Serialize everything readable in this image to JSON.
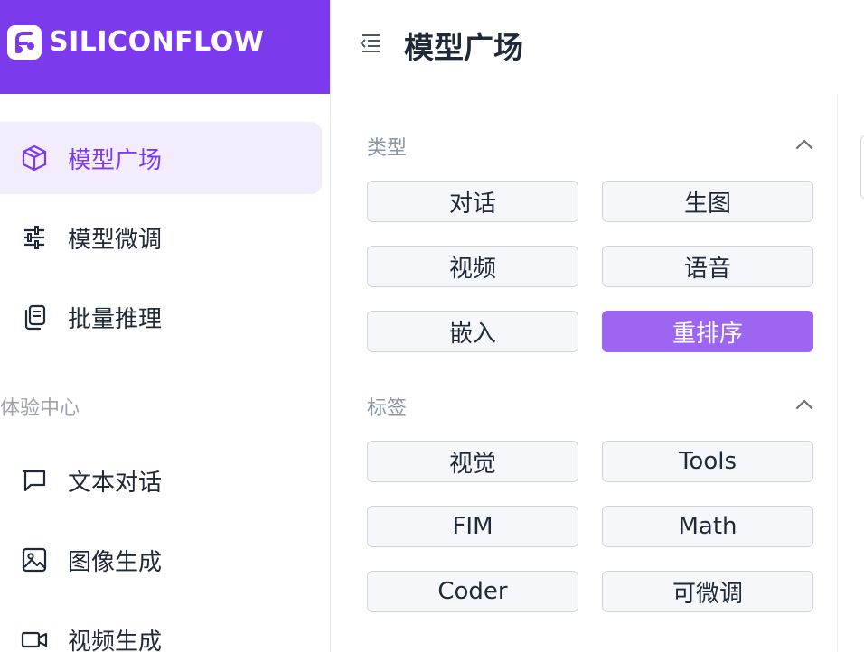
{
  "brand": {
    "name": "SILICONFLOW",
    "accent": "#7c3aed"
  },
  "sidebar": {
    "items": [
      {
        "label": "模型广场",
        "icon": "cube-icon",
        "active": true
      },
      {
        "label": "模型微调",
        "icon": "sliders-icon",
        "active": false
      },
      {
        "label": "批量推理",
        "icon": "copy-icon",
        "active": false
      }
    ],
    "section_title": "体验中心",
    "experience_items": [
      {
        "label": "文本对话",
        "icon": "chat-icon"
      },
      {
        "label": "图像生成",
        "icon": "image-icon"
      },
      {
        "label": "视频生成",
        "icon": "video-icon"
      }
    ]
  },
  "header": {
    "title": "模型广场"
  },
  "filters": {
    "type": {
      "label": "类型",
      "options": [
        "对话",
        "生图",
        "视频",
        "语音",
        "嵌入",
        "重排序"
      ],
      "selected": "重排序"
    },
    "tags": {
      "label": "标签",
      "options": [
        "视觉",
        "Tools",
        "FIM",
        "Math",
        "Coder",
        "可微调"
      ]
    },
    "selected_color": "#9c66f1"
  }
}
